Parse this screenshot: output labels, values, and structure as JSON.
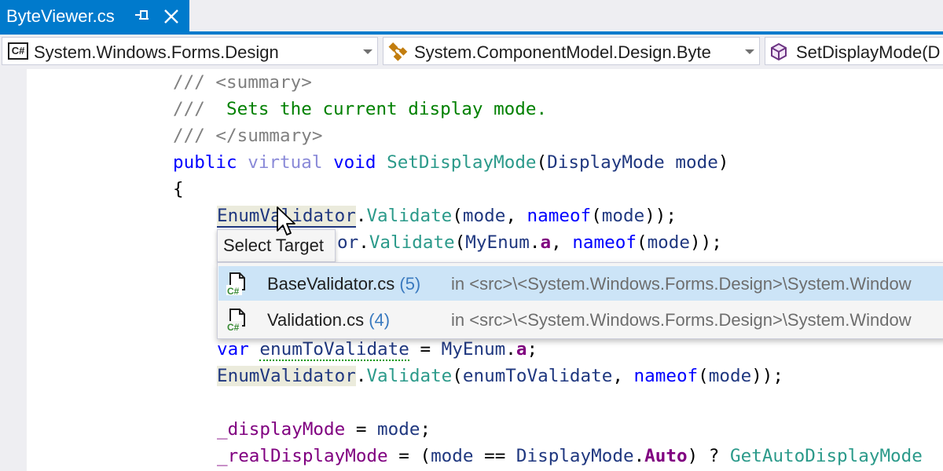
{
  "tab": {
    "title": "ByteViewer.cs"
  },
  "navbar": {
    "project": {
      "badge": "C#",
      "label": "System.Windows.Forms.Design"
    },
    "type": {
      "label": "System.ComponentModel.Design.Byte"
    },
    "member": {
      "label": "SetDisplayMode(D"
    }
  },
  "code": {
    "l1_a": "/// ",
    "l1_b": "<summary>",
    "l2_a": "///  ",
    "l2_b": "Sets the current display mode.",
    "l3_a": "/// ",
    "l3_b": "</summary>",
    "l4_public": "public",
    "l4_virtual": "virtual",
    "l4_void": "void",
    "l4_method": "SetDisplayMode",
    "l4_open": "(",
    "l4_type": "DisplayMode",
    "l4_param": "mode",
    "l4_close": ")",
    "l5": "{",
    "l6_type": "EnumValidator",
    "l6_dot": ".",
    "l6_method": "Validate",
    "l6_open": "(",
    "l6_mode": "mode",
    "l6_comma": ", ",
    "l6_nameof": "nameof",
    "l6_open2": "(",
    "l6_mode2": "mode",
    "l6_end": "));",
    "l7_type_tail": "or",
    "l7_dot": ".",
    "l7_method": "Validate",
    "l7_open": "(",
    "l7_enum": "MyEnum",
    "l7_dot2": ".",
    "l7_member": "a",
    "l7_comma": ", ",
    "l7_nameof": "nameof",
    "l7_open2": "(",
    "l7_mode": "mode",
    "l7_end": "));",
    "l8_var": "var",
    "l8_name": "enumToValidate",
    "l8_eq": " = ",
    "l8_enum": "MyEnum",
    "l8_dot": ".",
    "l8_member": "a",
    "l8_end": ";",
    "l9_type": "EnumValidator",
    "l9_dot": ".",
    "l9_method": "Validate",
    "l9_open": "(",
    "l9_arg": "enumToValidate",
    "l9_comma": ", ",
    "l9_nameof": "nameof",
    "l9_open2": "(",
    "l9_mode": "mode",
    "l9_end": "));",
    "l10_field": "_displayMode",
    "l10_eq": " = ",
    "l10_mode": "mode",
    "l10_end": ";",
    "l11_field": "_realDisplayMode",
    "l11_eq": " = ",
    "l11_open": "(",
    "l11_mode": "mode",
    "l11_op": " == ",
    "l11_type": "DisplayMode",
    "l11_dot": ".",
    "l11_member": "Auto",
    "l11_close": ")",
    "l11_q": " ? ",
    "l11_method": "GetAutoDisplayMode"
  },
  "popup": {
    "title": "Select Target",
    "results": [
      {
        "name": "BaseValidator.cs",
        "count": "(5)",
        "path": "in <src>\\<System.Windows.Forms.Design>\\System.Window",
        "icon": "csharp-file-icon"
      },
      {
        "name": "Validation.cs",
        "count": "(4)",
        "path": "in <src>\\<System.Windows.Forms.Design>\\System.Window",
        "icon": "csharp-file-icon"
      }
    ]
  },
  "colors": {
    "accent": "#007acc",
    "keyword": "#0000ff",
    "type": "#2b91af",
    "comment": "#008000",
    "selection": "#cce4f7"
  }
}
